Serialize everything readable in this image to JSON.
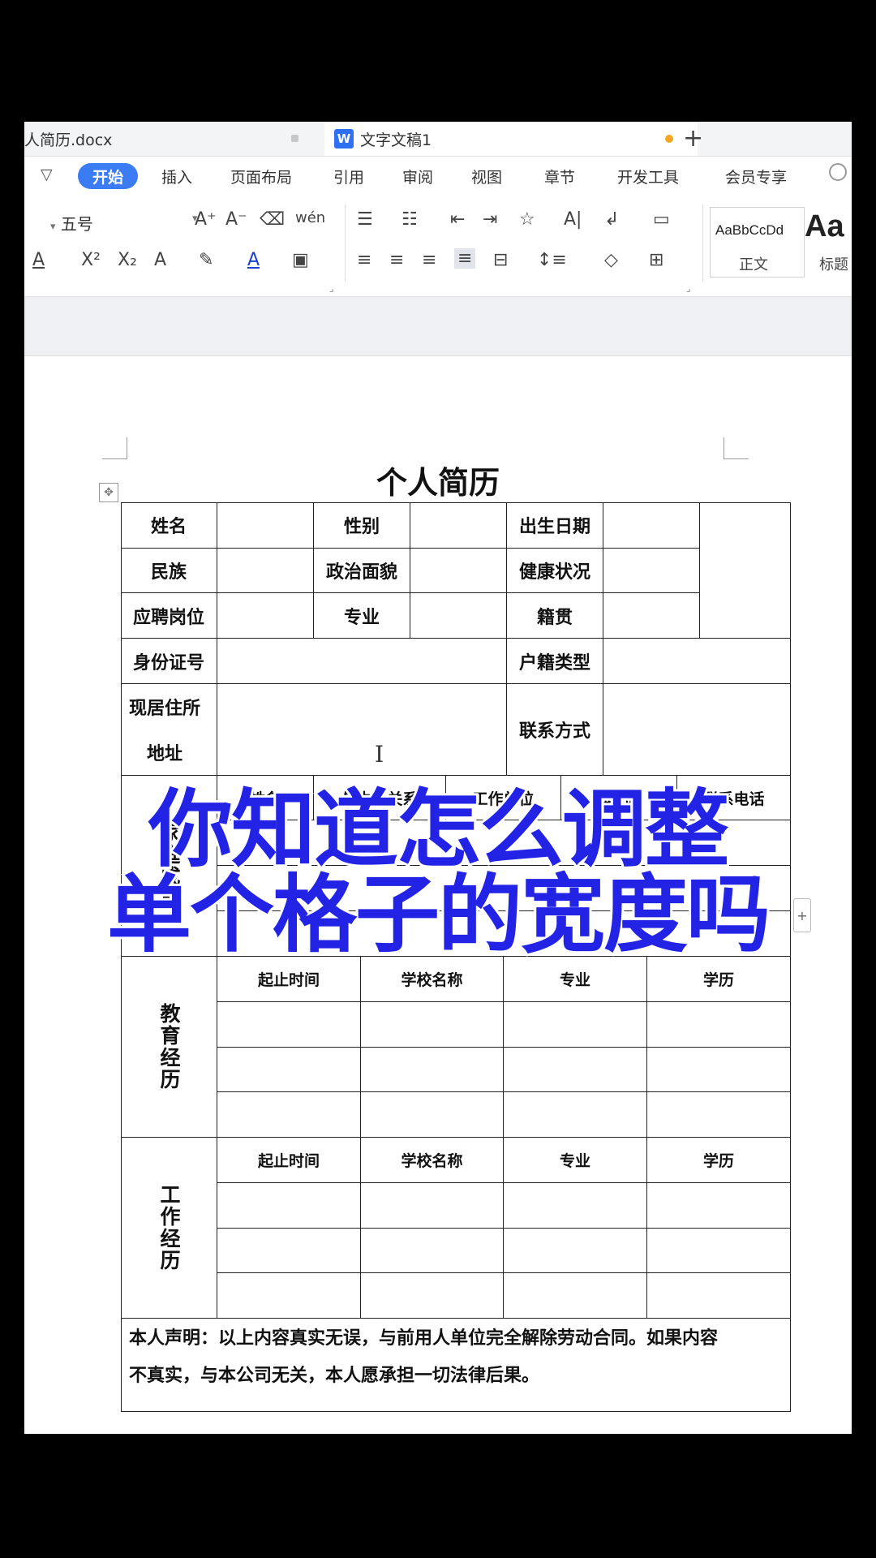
{
  "tabs": [
    {
      "label": "人简历.docx"
    },
    {
      "label": "文字文稿1",
      "icon": "W"
    }
  ],
  "tab_new": "+",
  "menu": {
    "collapse": "▽",
    "active": "开始",
    "items": [
      "插入",
      "页面布局",
      "引用",
      "审阅",
      "视图",
      "章节",
      "开发工具",
      "会员专享"
    ]
  },
  "ribbon": {
    "font_size": "五号",
    "row1": [
      "A⁺",
      "A⁻",
      "⌫",
      "wén",
      "☰",
      "☷",
      "⇤",
      "⇥",
      "☆",
      "A|",
      "↲",
      "▭"
    ],
    "row2": [
      "A",
      "X²",
      "X₂",
      "A",
      "✎",
      "A",
      "▣",
      "≡",
      "≡",
      "≡",
      "≡",
      "⊟",
      "↕≡",
      "◇",
      "⊞"
    ],
    "style_preview": "AaBbCcDd",
    "style_name": "正文",
    "style2_preview": "Aa",
    "style2_name": "标题"
  },
  "document": {
    "title": "个人简历",
    "rows": {
      "name": "姓名",
      "gender": "性别",
      "birth": "出生日期",
      "ethnicity": "民族",
      "political": "政治面貌",
      "health": "健康状况",
      "position": "应聘岗位",
      "major": "专业",
      "origin": "籍贯",
      "id": "身份证号",
      "hukou": "户籍类型",
      "address_l1": "现居住所",
      "address_l2": "地址",
      "contact": "联系方式"
    },
    "family": {
      "label": "家庭成员",
      "headers": [
        "姓名",
        "与本人关系",
        "工作单位",
        "职位",
        "联系电话"
      ]
    },
    "education": {
      "label": "教育经历",
      "headers": [
        "起止时间",
        "学校名称",
        "专业",
        "学历"
      ]
    },
    "work": {
      "label": "工作经历",
      "headers": [
        "起止时间",
        "学校名称",
        "专业",
        "学历"
      ]
    },
    "declaration_l1": "本人声明：以上内容真实无误，与前用人单位完全解除劳动合同。如果内容",
    "declaration_l2": "不真实，与本公司无关，本人愿承担一切法律后果。"
  },
  "overlay": {
    "line1": "你知道怎么调整",
    "line2": "单个格子的宽度吗"
  },
  "colors": {
    "accent": "#3b7cf5",
    "overlay_text": "#2323e6",
    "modified_dot": "#f5a623"
  }
}
